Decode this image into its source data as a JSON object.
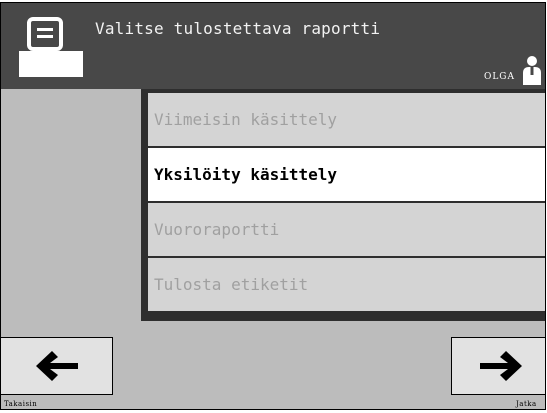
{
  "header": {
    "title": "Valitse tulostettava raportti",
    "icon": "printer-icon",
    "user": {
      "name": "OLGA",
      "icon": "user-icon"
    }
  },
  "menu": {
    "items": [
      {
        "label": "Viimeisin käsittely",
        "selected": false
      },
      {
        "label": "Yksilöity käsittely",
        "selected": true
      },
      {
        "label": "Vuororaportti",
        "selected": false
      },
      {
        "label": "Tulosta etiketit",
        "selected": false
      }
    ]
  },
  "footer": {
    "back": {
      "label": "Takaisin",
      "icon": "arrow-left-icon"
    },
    "next": {
      "label": "Jatka",
      "icon": "arrow-right-icon"
    }
  },
  "colors": {
    "header_bg": "#484848",
    "screen_bg": "#bcbcbc",
    "item_bg": "#d4d4d4",
    "item_selected_bg": "#ffffff",
    "item_text_disabled": "#a0a0a0"
  }
}
